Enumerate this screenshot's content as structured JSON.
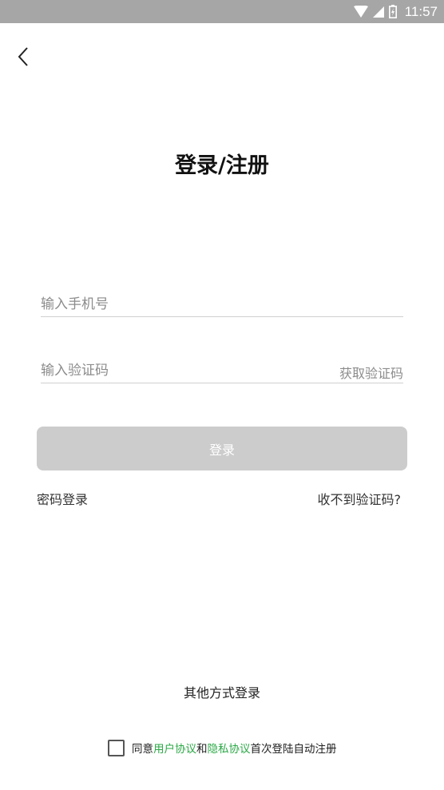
{
  "status_bar": {
    "time": "11:57",
    "icons": [
      "wifi-icon",
      "signal-icon",
      "battery-icon"
    ]
  },
  "header": {
    "back_icon": "chevron-left-icon",
    "title": "登录/注册"
  },
  "form": {
    "phone_placeholder": "输入手机号",
    "code_placeholder": "输入验证码",
    "get_code_label": "获取验证码",
    "login_label": "登录"
  },
  "links": {
    "password_login": "密码登录",
    "no_code": "收不到验证码?"
  },
  "footer": {
    "other_login": "其他方式登录",
    "agreement": {
      "prefix": "同意",
      "user_agreement": "用户协议",
      "and": "和",
      "privacy_agreement": "隐私协议",
      "suffix": "首次登陆自动注册"
    }
  },
  "colors": {
    "status_bar": "#a6a6a6",
    "button_disabled": "#cccccc",
    "link_green": "#2aa845"
  }
}
